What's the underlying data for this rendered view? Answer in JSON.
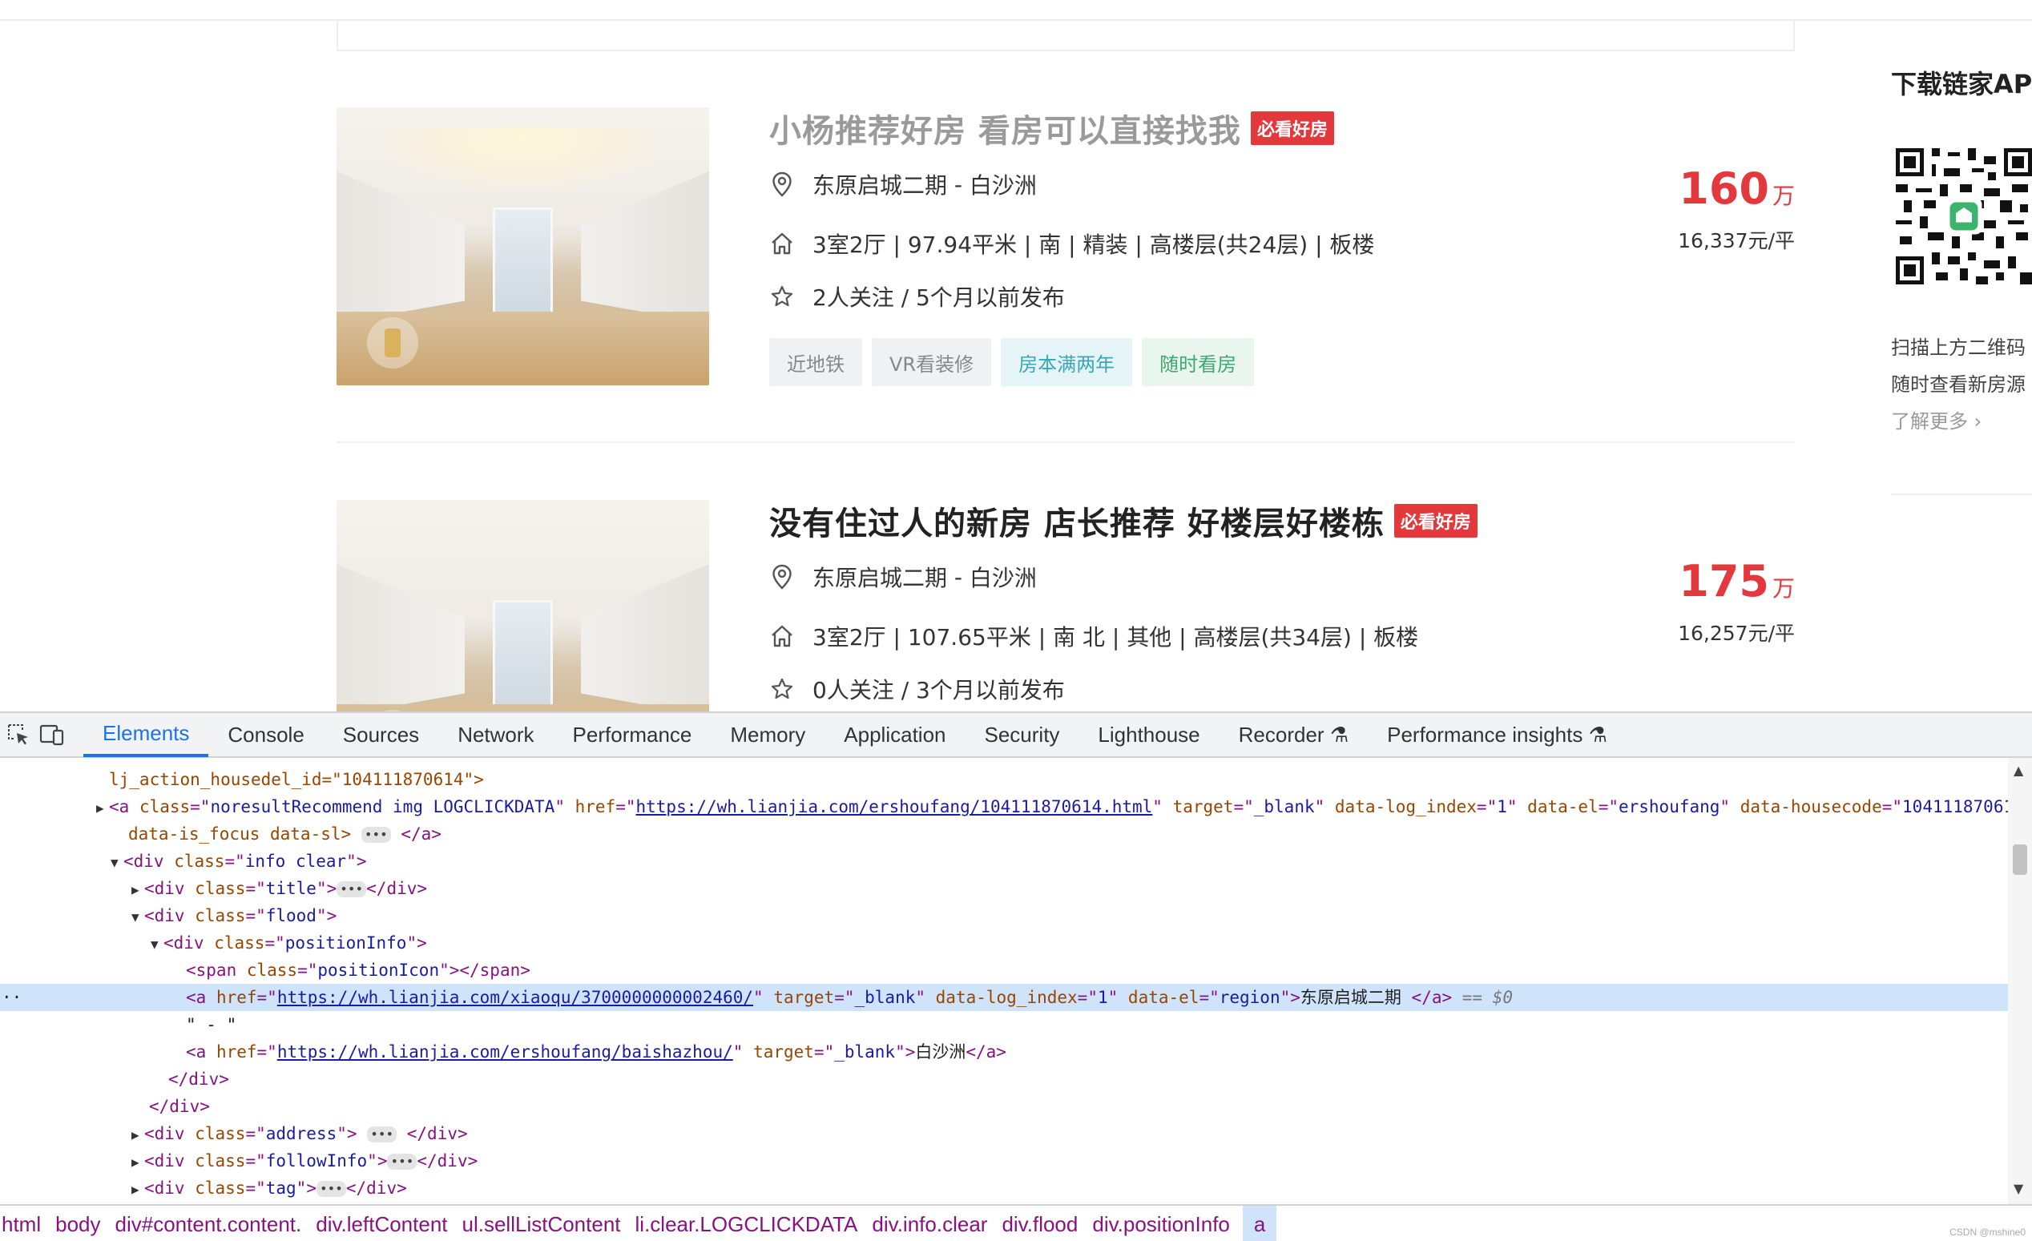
{
  "listings": [
    {
      "title": "小杨推荐好房 看房可以直接找我",
      "title_visited": true,
      "badge": "必看好房",
      "community": "东原启城二期",
      "separator": " - ",
      "area": "白沙洲",
      "house_info": "3室2厅 | 97.94平米 | 南 | 精装 | 高楼层(共24层) | 板楼",
      "follow_info": "2人关注 / 5个月以前发布",
      "tags": [
        {
          "label": "近地铁",
          "style": "grey"
        },
        {
          "label": "VR看装修",
          "style": "grey"
        },
        {
          "label": "房本满两年",
          "style": "blue"
        },
        {
          "label": "随时看房",
          "style": "green"
        }
      ],
      "price_total": "160",
      "price_unit_wan": "万",
      "unit_price": "16,337元/平"
    },
    {
      "title": "没有住过人的新房 店长推荐 好楼层好楼栋",
      "title_visited": false,
      "badge": "必看好房",
      "community": "东原启城二期",
      "separator": " - ",
      "area": "白沙洲",
      "house_info": "3室2厅 | 107.65平米 | 南 北 | 其他 | 高楼层(共34层) | 板楼",
      "follow_info": "0人关注 / 3个月以前发布",
      "tags": [],
      "price_total": "175",
      "price_unit_wan": "万",
      "unit_price": "16,257元/平"
    }
  ],
  "sidebar": {
    "heading": "下载链家AP",
    "line1": "扫描上方二维码",
    "line2": "随时查看新房源",
    "more": "了解更多 ›"
  },
  "devtools": {
    "tabs": [
      "Elements",
      "Console",
      "Sources",
      "Network",
      "Performance",
      "Memory",
      "Application",
      "Security",
      "Lighthouse",
      "Recorder ⚗",
      "Performance insights ⚗"
    ],
    "active_tab": "Elements",
    "code": {
      "l0_attr": "lj_action_housedel_id=\"104111870614\">",
      "l1_class": "noresultRecommend img LOGCLICKDATA",
      "l1_href": "https://wh.lianjia.com/ershoufang/104111870614.html",
      "l1_target": "_blank",
      "l1_logindex": "1",
      "l1_el": "ershoufang",
      "l1_housecode": "104111870614",
      "l1_tail": "data-is_focus data-sl>",
      "l2_class": "info clear",
      "l3_class": "title",
      "l4_class": "flood",
      "l5_class": "positionInfo",
      "l6_class": "positionIcon",
      "l7_href": "https://wh.lianjia.com/xiaoqu/3700000000002460/",
      "l7_target": "_blank",
      "l7_logindex": "1",
      "l7_el": "region",
      "l7_text": "东原启城二期 ",
      "l7_eq": "== $0",
      "l8_text": "\" - \"",
      "l9_href": "https://wh.lianjia.com/ershoufang/baishazhou/",
      "l9_target": "_blank",
      "l9_text": "白沙洲",
      "l13_class": "address",
      "l14_class": "followInfo",
      "l15_class": "tag"
    },
    "breadcrumbs": [
      "html",
      "body",
      "div#content.content.",
      "div.leftContent",
      "ul.sellListContent",
      "li.clear.LOGCLICKDATA",
      "div.info.clear",
      "div.flood",
      "div.positionInfo",
      "a"
    ],
    "credit": "CSDN @mshine0"
  }
}
